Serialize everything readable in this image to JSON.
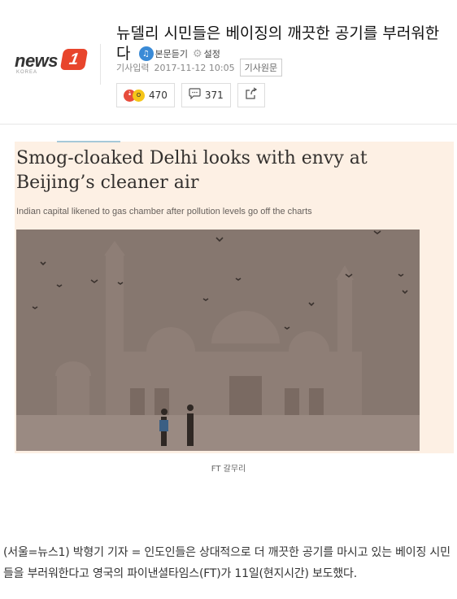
{
  "logo": {
    "text": "news",
    "badge": "1",
    "sub": "KOREA"
  },
  "headline": {
    "title": "뉴델리 시민들은 베이징의 깨끗한 공기를 부러워한다",
    "listen_label": "본문듣기",
    "settings_label": "설정"
  },
  "meta": {
    "input_label": "기사입력",
    "timestamp": "2017-11-12 10:05",
    "original_button": "기사원문"
  },
  "reactions": {
    "emotion_count": "470",
    "comment_count": "371"
  },
  "figure": {
    "ft_title": "Smog-cloaked Delhi looks with envy at Beijing’s cleaner air",
    "ft_subtitle": "Indian capital likened to gas chamber after pollution levels go off the charts",
    "caption": "FT 갈무리"
  },
  "article": {
    "body": "(서울=뉴스1) 박형기 기자 = 인도인들은 상대적으로 더 깨끗한 공기를 마시고 있는 베이징 시민들을 부러워한다고 영국의 파이낸셜타임스(FT)가 11일(현지시간) 보도했다."
  },
  "colors": {
    "brand_red": "#e8452c",
    "ft_background": "#fdf0e4",
    "listen_blue": "#3a8ad6"
  }
}
